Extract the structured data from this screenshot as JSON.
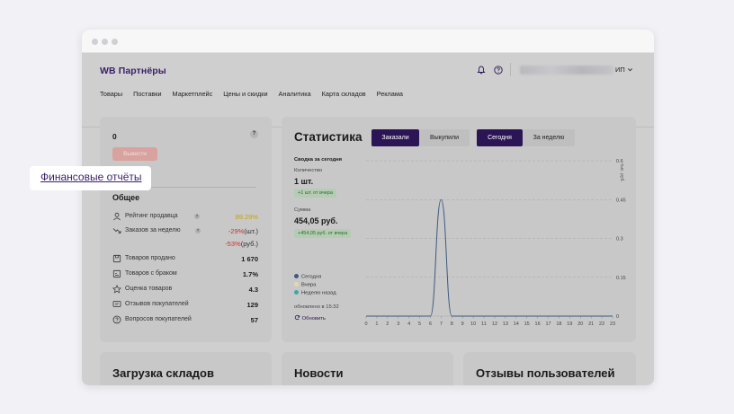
{
  "header": {
    "logo": "WB Партнёры",
    "user_suffix": "ИП",
    "nav": [
      "Товары",
      "Поставки",
      "Маркетплейс",
      "Цены и скидки",
      "Аналитика",
      "Карта складов",
      "Реклама"
    ]
  },
  "finance": {
    "balance": "0",
    "withdraw_label": "Вывести",
    "reports_link": "Финансовые отчёты",
    "general_title": "Общее",
    "rating_label": "Рейтинг продавца",
    "rating_value": "89.29%",
    "orders_label": "Заказов за неделю",
    "orders_change_pcs": "-29%",
    "orders_change_pcs_unit": "(шт.)",
    "orders_change_rub": "-53%",
    "orders_change_rub_unit": "(руб.)",
    "stats": [
      {
        "label": "Товаров продано",
        "value": "1 670"
      },
      {
        "label": "Товаров с браком",
        "value": "1.7%"
      },
      {
        "label": "Оценка товаров",
        "value": "4.3"
      },
      {
        "label": "Отзывов покупателей",
        "value": "129"
      },
      {
        "label": "Вопросов покупателей",
        "value": "57"
      }
    ]
  },
  "statistics": {
    "title": "Статистика",
    "tabs_type": [
      "Заказали",
      "Выкупили"
    ],
    "tabs_period": [
      "Сегодня",
      "За неделю"
    ],
    "summary_title": "Сводка за сегодня",
    "quantity_label": "Количество",
    "quantity_value": "1 шт.",
    "quantity_delta": "+1 шт. от вчера",
    "sum_label": "Сумма",
    "sum_value": "454,05 руб.",
    "sum_delta": "+454,05 руб. от вчера",
    "legend": [
      "Сегодня",
      "Вчера",
      "Неделю назад"
    ],
    "updated": "обновлено в 15:32",
    "refresh": "Обновить",
    "colors": {
      "today": "#3d5a80",
      "yesterday": "#e8d7a8",
      "week_ago": "#3fa7a7"
    }
  },
  "chart_data": {
    "type": "line",
    "x": [
      0,
      1,
      2,
      3,
      4,
      5,
      6,
      7,
      8,
      9,
      10,
      11,
      12,
      13,
      14,
      15,
      16,
      17,
      18,
      19,
      20,
      21,
      22,
      23
    ],
    "series": [
      {
        "name": "Сегодня",
        "values": [
          0,
          0,
          0,
          0,
          0,
          0,
          0,
          0.45,
          0,
          0,
          0,
          0,
          0,
          0,
          0,
          0,
          0,
          0,
          0,
          0,
          0,
          0,
          0,
          0
        ]
      }
    ],
    "ylabel": "тыс. руб.",
    "yticks": [
      "0",
      "0.15",
      "0.3",
      "0.45",
      "0.6"
    ],
    "ylim": [
      0,
      0.6
    ],
    "grid": true
  },
  "bottom": {
    "warehouse": "Загрузка складов",
    "news": "Новости",
    "reviews": "Отзывы пользователей"
  }
}
